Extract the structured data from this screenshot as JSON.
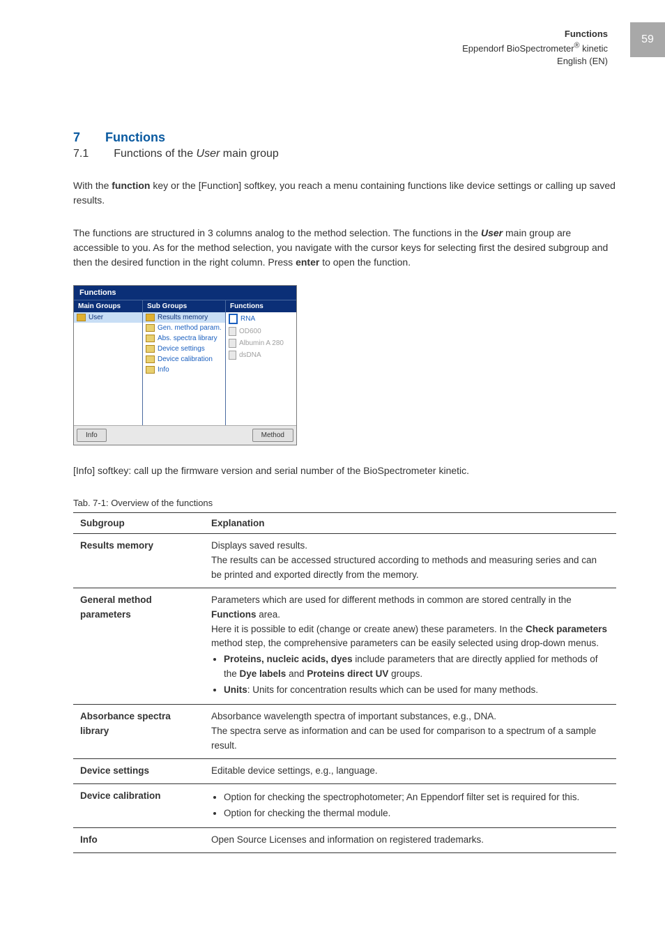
{
  "header": {
    "line1": "Functions",
    "line2a": "Eppendorf BioSpectrometer",
    "line2b": " kinetic",
    "line3": "English (EN)",
    "page": "59"
  },
  "section": {
    "num": "7",
    "title": "Functions"
  },
  "subsection": {
    "num": "7.1",
    "title_a": "Functions of the ",
    "title_i": "User",
    "title_b": " main group"
  },
  "para1_a": "With the ",
  "para1_b": "function",
  "para1_c": " key or the [Function] softkey, you reach a menu containing functions like device settings or calling up saved results.",
  "para2_a": "The functions are structured in 3 columns analog to the method selection. The functions in the ",
  "para2_b": "User",
  "para2_c": " main group are accessible to you. As for the method selection, you navigate with the cursor keys for selecting first the desired subgroup and then the desired function in the right column. Press ",
  "para2_d": "enter",
  "para2_e": " to open the function.",
  "shot": {
    "title": "Functions",
    "col1": "Main Groups",
    "col2": "Sub Groups",
    "col3": "Functions",
    "main_items": [
      "User"
    ],
    "sub_items": [
      "Results memory",
      "Gen. method param.",
      "Abs. spectra library",
      "Device settings",
      "Device calibration",
      "Info"
    ],
    "func_items": [
      "RNA",
      "OD600",
      "Albumin A 280",
      "dsDNA"
    ],
    "btn_left": "Info",
    "btn_right": "Method"
  },
  "caption_after_shot": "[Info] softkey: call up the firmware version and serial number of the BioSpectrometer kinetic.",
  "tab_caption": "Tab. 7-1:   Overview of the functions",
  "thead": {
    "c1": "Subgroup",
    "c2": "Explanation"
  },
  "rows": {
    "r1": {
      "name": "Results memory",
      "t1": "Displays saved results.",
      "t2": "The results can be accessed structured according to methods and measuring series and can be printed and exported directly from the memory."
    },
    "r2": {
      "name": "General method parameters",
      "t1a": "Parameters which are used for different methods in common are stored centrally in the ",
      "t1b": "Functions",
      "t1c": " area.",
      "t2a": "Here it is possible to edit (change or create anew) these parameters. In the ",
      "t2b": "Check parameters",
      "t2c": " method step, the comprehensive parameters can be easily selected using drop-down menus.",
      "b1a": "Proteins, nucleic acids, dyes",
      "b1b": " include parameters that are directly applied for methods of the ",
      "b1c": "Dye labels",
      "b1d": " and ",
      "b1e": "Proteins direct UV",
      "b1f": " groups.",
      "b2a": "Units",
      "b2b": ": Units for concentration results which can be used for many methods."
    },
    "r3": {
      "name": "Absorbance spectra library",
      "t1": "Absorbance wavelength spectra of important substances, e.g., DNA.",
      "t2": "The spectra serve as information and can be used for comparison to a spectrum of a sample result."
    },
    "r4": {
      "name": "Device settings",
      "t1": "Editable device settings, e.g., language."
    },
    "r5": {
      "name": "Device calibration",
      "b1": "Option for checking the spectrophotometer; An Eppendorf filter set is required for this.",
      "b2": "Option for checking the thermal module."
    },
    "r6": {
      "name": "Info",
      "t1": "Open Source Licenses and information on registered trademarks."
    }
  }
}
